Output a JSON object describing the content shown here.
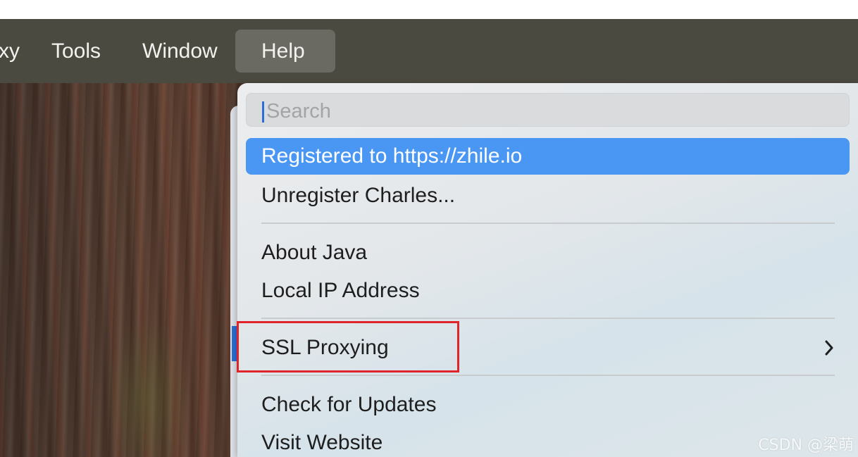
{
  "menubar": {
    "items": [
      {
        "label": "xy"
      },
      {
        "label": "Tools"
      },
      {
        "label": "Window"
      },
      {
        "label": "Help",
        "active": true
      }
    ]
  },
  "help_menu": {
    "search": {
      "placeholder": "Search",
      "value": ""
    },
    "items": {
      "registered": "Registered to https://zhile.io",
      "unregister": "Unregister Charles...",
      "about_java": "About Java",
      "local_ip": "Local IP Address",
      "ssl_proxying": "SSL Proxying",
      "check_updates": "Check for Updates",
      "visit_website": "Visit Website"
    },
    "submenu_icon": "chevron-right-icon"
  },
  "annotation": {
    "color": "#e0242b"
  },
  "watermark": "CSDN @梁萌",
  "colors": {
    "highlight": "#4a97f3",
    "menubar": "#4b4a40"
  }
}
